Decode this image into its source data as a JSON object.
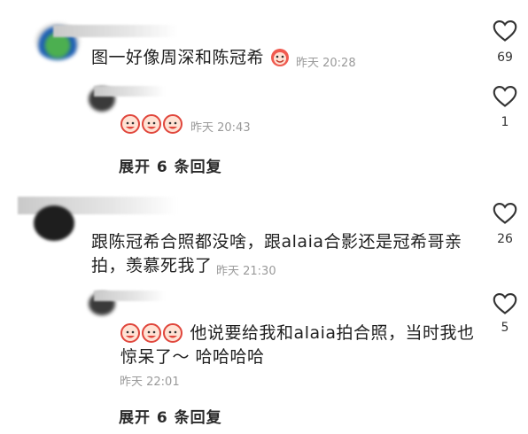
{
  "comments": [
    {
      "text": "图一好像周深和陈冠希",
      "time": "昨天 20:28",
      "likes": "69",
      "reply": {
        "time": "昨天 20:43",
        "likes": "1"
      },
      "expand": "展开 6 条回复"
    },
    {
      "text_line1": "跟陈冠希合照都没啥，跟alaia合影还是冠希哥亲",
      "text_line2": "拍，羡慕死我了",
      "time": "昨天 21:30",
      "likes": "26",
      "reply": {
        "text_line1": "他说要给我和alaia拍合照，当时我也",
        "text_line2": "惊呆了～ 哈哈哈哈",
        "time": "昨天 22:01",
        "likes": "5"
      },
      "expand": "展开 6 条回复"
    }
  ],
  "icons": {
    "like": "heart-outline-icon",
    "emoji": "crying-laughing-face-icon"
  },
  "colors": {
    "background": "#ffffff",
    "text": "#1f1f1f",
    "muted": "#9a9a9a",
    "emoji_red": "#e0463c"
  }
}
